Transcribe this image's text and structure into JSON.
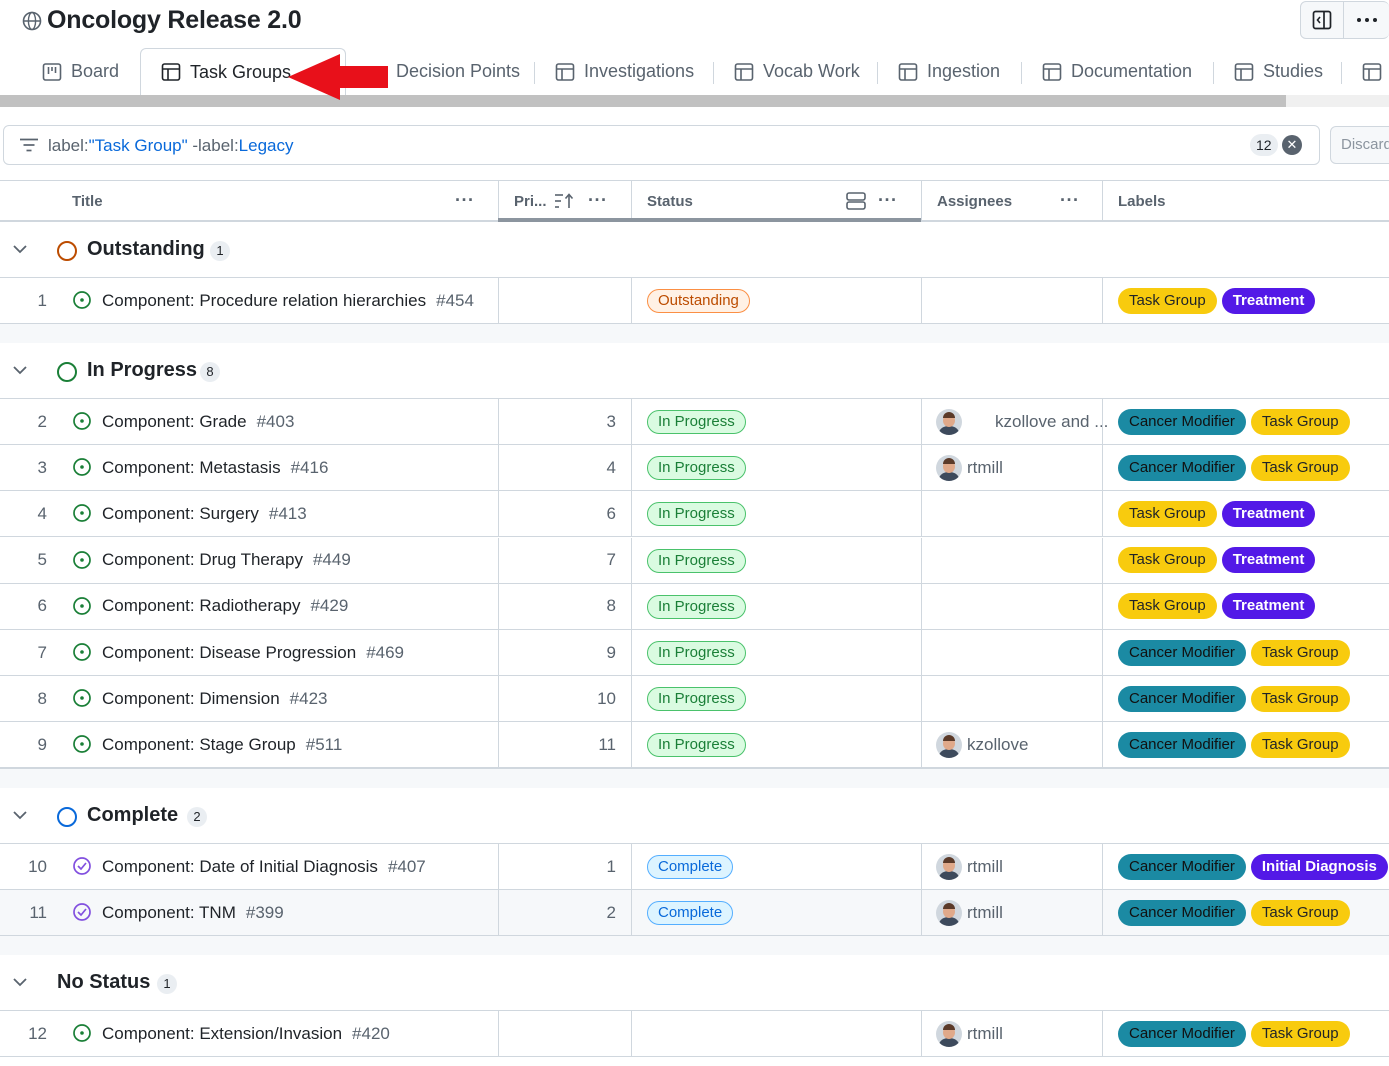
{
  "project": {
    "title": "Oncology Release 2.0",
    "icons": [
      "globe-icon",
      "side-panel-icon",
      "kebab-icon"
    ]
  },
  "tabs": [
    {
      "label": "Board",
      "icon": "board-icon",
      "active": false
    },
    {
      "label": "Task Groups",
      "icon": "table-icon",
      "active": true
    },
    {
      "label": "Decision Points",
      "icon": "table-icon",
      "active": false
    },
    {
      "label": "Investigations",
      "icon": "table-icon",
      "active": false
    },
    {
      "label": "Vocab Work",
      "icon": "table-icon",
      "active": false
    },
    {
      "label": "Ingestion",
      "icon": "table-icon",
      "active": false
    },
    {
      "label": "Documentation",
      "icon": "table-icon",
      "active": false
    },
    {
      "label": "Studies",
      "icon": "table-icon",
      "active": false
    }
  ],
  "annotation": {
    "type": "red-arrow",
    "color": "#e8101a",
    "points_to": "Task Groups"
  },
  "filter": {
    "prefix1": "label:",
    "value1": "\"Task Group\"",
    "prefix2": " -label:",
    "value2": "Legacy",
    "count": "12",
    "discard_label": "Discard"
  },
  "columns": {
    "title": "Title",
    "priority": "Pri...",
    "status": "Status",
    "assignees": "Assignees",
    "labels": "Labels"
  },
  "colors": {
    "outstanding": "#bc4c00",
    "in_progress": "#1a7f37",
    "complete": "#0969da",
    "label_task_group": "#f8cb0e",
    "label_treatment": "#5319e7",
    "label_cancer_modifier": "#1b8aa3",
    "label_initial_diagnosis": "#5319e7"
  },
  "groups": [
    {
      "name": "Outstanding",
      "count": "1"
    },
    {
      "name": "In Progress",
      "count": "8"
    },
    {
      "name": "Complete",
      "count": "2"
    },
    {
      "name": "No Status",
      "count": "1"
    }
  ],
  "rows": [
    {
      "n": "1",
      "title": "Component: Procedure relation hierarchies",
      "num": "#454",
      "priority": "",
      "status": "Outstanding",
      "assignee": "",
      "labels": [
        "Task Group",
        "Treatment"
      ]
    },
    {
      "n": "2",
      "title": "Component: Grade",
      "num": "#403",
      "priority": "3",
      "status": "In Progress",
      "assignee": "kzollove and ...",
      "labels": [
        "Cancer Modifier",
        "Task Group"
      ]
    },
    {
      "n": "3",
      "title": "Component: Metastasis",
      "num": "#416",
      "priority": "4",
      "status": "In Progress",
      "assignee": "rtmill",
      "labels": [
        "Cancer Modifier",
        "Task Group"
      ]
    },
    {
      "n": "4",
      "title": "Component: Surgery",
      "num": "#413",
      "priority": "6",
      "status": "In Progress",
      "assignee": "",
      "labels": [
        "Task Group",
        "Treatment"
      ]
    },
    {
      "n": "5",
      "title": "Component: Drug Therapy",
      "num": "#449",
      "priority": "7",
      "status": "In Progress",
      "assignee": "",
      "labels": [
        "Task Group",
        "Treatment"
      ]
    },
    {
      "n": "6",
      "title": "Component: Radiotherapy",
      "num": "#429",
      "priority": "8",
      "status": "In Progress",
      "assignee": "",
      "labels": [
        "Task Group",
        "Treatment"
      ]
    },
    {
      "n": "7",
      "title": "Component: Disease Progression",
      "num": "#469",
      "priority": "9",
      "status": "In Progress",
      "assignee": "",
      "labels": [
        "Cancer Modifier",
        "Task Group"
      ]
    },
    {
      "n": "8",
      "title": "Component: Dimension",
      "num": "#423",
      "priority": "10",
      "status": "In Progress",
      "assignee": "",
      "labels": [
        "Cancer Modifier",
        "Task Group"
      ]
    },
    {
      "n": "9",
      "title": "Component: Stage Group",
      "num": "#511",
      "priority": "11",
      "status": "In Progress",
      "assignee": "kzollove",
      "labels": [
        "Cancer Modifier",
        "Task Group"
      ]
    },
    {
      "n": "10",
      "title": "Component: Date of Initial Diagnosis",
      "num": "#407",
      "priority": "1",
      "status": "Complete",
      "assignee": "rtmill",
      "labels": [
        "Cancer Modifier",
        "Initial Diagnosis"
      ]
    },
    {
      "n": "11",
      "title": "Component: TNM",
      "num": "#399",
      "priority": "2",
      "status": "Complete",
      "assignee": "rtmill",
      "labels": [
        "Cancer Modifier",
        "Task Group"
      ]
    },
    {
      "n": "12",
      "title": "Component: Extension/Invasion",
      "num": "#420",
      "priority": "",
      "status": "",
      "assignee": "rtmill",
      "labels": [
        "Cancer Modifier",
        "Task Group"
      ]
    }
  ]
}
